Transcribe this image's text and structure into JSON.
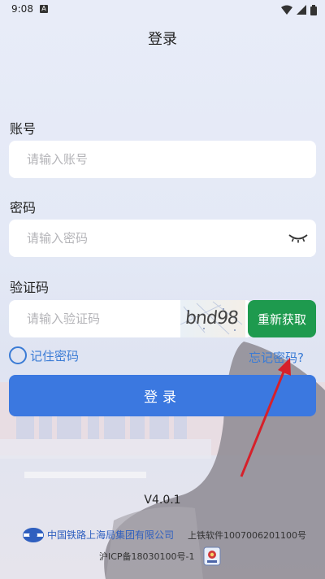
{
  "status_bar": {
    "time": "9:08",
    "notif_letter": "A",
    "icons": [
      "wifi-icon",
      "signal-icon",
      "battery-icon"
    ]
  },
  "page": {
    "title": "登录"
  },
  "form": {
    "account": {
      "label": "账号",
      "placeholder": "请输入账号"
    },
    "password": {
      "label": "密码",
      "placeholder": "请输入密码",
      "toggle_icon": "eye-closed-icon"
    },
    "captcha": {
      "label": "验证码",
      "placeholder": "请输入验证码",
      "image_text": "bnd98",
      "refresh_label": "重新获取"
    },
    "remember_label": "记住密码",
    "forgot_label": "忘记密码?",
    "login_label": "登录"
  },
  "footer": {
    "version": "V4.0.1",
    "company": "中国铁路上海局集团有限公司",
    "software_no": "上铁软件1007006201100号",
    "icp": "沪ICP备18030100号-1"
  },
  "colors": {
    "accent": "#3b78e0",
    "link": "#3a7bd5",
    "refresh_button": "#1e9a4e",
    "annotation_arrow": "#d6202a"
  }
}
